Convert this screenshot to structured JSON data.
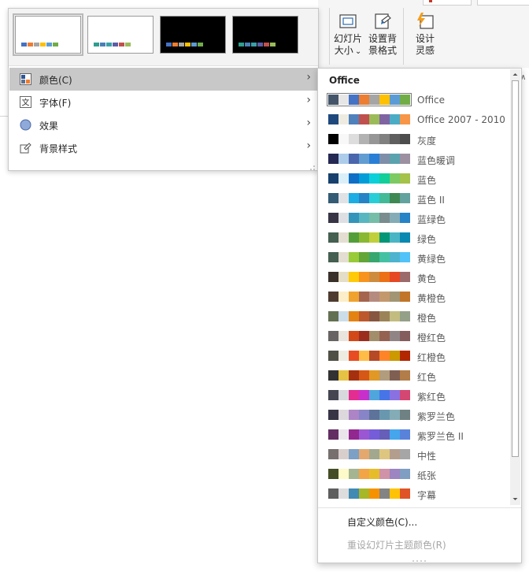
{
  "ribbon": {
    "slide_size": {
      "line1": "幻灯片",
      "line2": "大小",
      "caret": "⌄"
    },
    "format_background": {
      "line1": "设置背",
      "line2": "景格式"
    },
    "designer": {
      "line1": "设计",
      "line2": "灵感"
    }
  },
  "variants": {
    "thumbnails": [
      {
        "bg": "#ffffff",
        "selected": true,
        "bars": [
          "#4472c4",
          "#ed7d31",
          "#a5a5a5",
          "#ffc000",
          "#5b9bd5",
          "#70ad47"
        ]
      },
      {
        "bg": "#ffffff",
        "selected": false,
        "bars": [
          "#2f9e8f",
          "#4a7fb5",
          "#3aa0a8",
          "#5b5ea6",
          "#c0504d",
          "#9bbb59"
        ]
      },
      {
        "bg": "#000000",
        "selected": false,
        "bars": [
          "#4472c4",
          "#ed7d31",
          "#a5a5a5",
          "#ffc000",
          "#5b9bd5",
          "#70ad47"
        ]
      },
      {
        "bg": "#000000",
        "selected": false,
        "bars": [
          "#2f9e8f",
          "#4a7fb5",
          "#3aa0a8",
          "#5b5ea6",
          "#c0504d",
          "#9bbb59"
        ]
      }
    ],
    "menu": [
      {
        "label": "颜色(C)",
        "icon": "color-scheme-icon"
      },
      {
        "label": "字体(F)",
        "icon": "font-icon"
      },
      {
        "label": "效果",
        "icon": "effects-icon"
      },
      {
        "label": "背景样式",
        "icon": "background-style-icon"
      }
    ]
  },
  "colors_menu": {
    "heading": "Office",
    "schemes": [
      {
        "name": "Office",
        "selected": true,
        "colors": [
          "#44546a",
          "#e7e6e6",
          "#4472c4",
          "#ed7d31",
          "#a5a5a5",
          "#ffc000",
          "#5b9bd5",
          "#70ad47"
        ]
      },
      {
        "name": "Office 2007 - 2010",
        "colors": [
          "#1f497d",
          "#eeece1",
          "#4f81bd",
          "#c0504d",
          "#9bbb59",
          "#8064a2",
          "#4bacc6",
          "#f79646"
        ]
      },
      {
        "name": "灰度",
        "colors": [
          "#000000",
          "#f8f8f8",
          "#dddddd",
          "#b2b2b2",
          "#969696",
          "#808080",
          "#5f5f5f",
          "#4d4d4d"
        ]
      },
      {
        "name": "蓝色暖调",
        "colors": [
          "#242852",
          "#acccea",
          "#4a66ac",
          "#629dd1",
          "#297fd5",
          "#7f8fa9",
          "#5aa2ae",
          "#9d90a0"
        ]
      },
      {
        "name": "蓝色",
        "colors": [
          "#17406d",
          "#dbeff9",
          "#0f6fc6",
          "#009dd9",
          "#0bd0d9",
          "#10cf9b",
          "#7cca62",
          "#a5c249"
        ]
      },
      {
        "name": "蓝色 II",
        "colors": [
          "#335b74",
          "#dfe3e5",
          "#1cade4",
          "#2683c6",
          "#27ced7",
          "#42ba97",
          "#3e8853",
          "#62a39f"
        ]
      },
      {
        "name": "蓝绿色",
        "colors": [
          "#373545",
          "#dedfe2",
          "#3494ba",
          "#58b6c0",
          "#75bda7",
          "#7a8c8e",
          "#84acb6",
          "#2683c6"
        ]
      },
      {
        "name": "绿色",
        "colors": [
          "#455f51",
          "#e3ded1",
          "#549e39",
          "#8ab833",
          "#c0cf3a",
          "#029676",
          "#4ab5c4",
          "#0989b1"
        ]
      },
      {
        "name": "黄绿色",
        "colors": [
          "#455f51",
          "#e3ded1",
          "#99cb38",
          "#63a537",
          "#37a76f",
          "#44c1a3",
          "#4eb3cf",
          "#51c3f9"
        ]
      },
      {
        "name": "黄色",
        "colors": [
          "#39302a",
          "#e5dec6",
          "#ffca08",
          "#f8931d",
          "#ce8d3e",
          "#ec7016",
          "#e64823",
          "#9c6a6a"
        ]
      },
      {
        "name": "黄橙色",
        "colors": [
          "#4e3b30",
          "#fbeec9",
          "#f0a22e",
          "#a5644e",
          "#b58b80",
          "#c3986d",
          "#a19574",
          "#c17529"
        ]
      },
      {
        "name": "橙色",
        "colors": [
          "#637052",
          "#ccddea",
          "#e48312",
          "#bd582c",
          "#865640",
          "#9b8357",
          "#c2bc80",
          "#94a088"
        ]
      },
      {
        "name": "橙红色",
        "colors": [
          "#696464",
          "#e9e5dc",
          "#d34817",
          "#9b2d1f",
          "#a28e6a",
          "#956251",
          "#918485",
          "#855d5d"
        ]
      },
      {
        "name": "红橙色",
        "colors": [
          "#505046",
          "#eeece1",
          "#e84c22",
          "#ffbd47",
          "#b64926",
          "#ff8427",
          "#cc9900",
          "#b22600"
        ]
      },
      {
        "name": "红色",
        "colors": [
          "#323232",
          "#e5c243",
          "#a5300f",
          "#d55816",
          "#e19825",
          "#b19c7d",
          "#7f5f52",
          "#b27d49"
        ]
      },
      {
        "name": "紫红色",
        "colors": [
          "#454551",
          "#d8d9dc",
          "#e32d91",
          "#c830cc",
          "#4ea6dc",
          "#4775e7",
          "#8971e1",
          "#d54773"
        ]
      },
      {
        "name": "紫罗兰色",
        "colors": [
          "#373545",
          "#dcd8dc",
          "#ad84c6",
          "#8784c7",
          "#5d739a",
          "#6997af",
          "#84acb6",
          "#6f8183"
        ]
      },
      {
        "name": "紫罗兰色 II",
        "colors": [
          "#632e62",
          "#eae5eb",
          "#92278f",
          "#9b57d3",
          "#755dd9",
          "#665eb8",
          "#45a5ed",
          "#5982db"
        ]
      },
      {
        "name": "中性",
        "colors": [
          "#776f6e",
          "#d8cfcd",
          "#7da0c6",
          "#e4a86e",
          "#a2a88d",
          "#dfc680",
          "#b39e8d",
          "#a6a6a6"
        ]
      },
      {
        "name": "纸张",
        "colors": [
          "#444d26",
          "#fefac9",
          "#a5b592",
          "#f3a447",
          "#e7bc29",
          "#d092a7",
          "#9c85c0",
          "#809ec2"
        ]
      },
      {
        "name": "字幕",
        "colors": [
          "#5e5e5e",
          "#dddddd",
          "#418ab3",
          "#a6b727",
          "#f69200",
          "#838383",
          "#fec306",
          "#df5327"
        ]
      }
    ],
    "custom_label": "自定义颜色(C)...",
    "reset_label": "重设幻灯片主题颜色(R)"
  }
}
